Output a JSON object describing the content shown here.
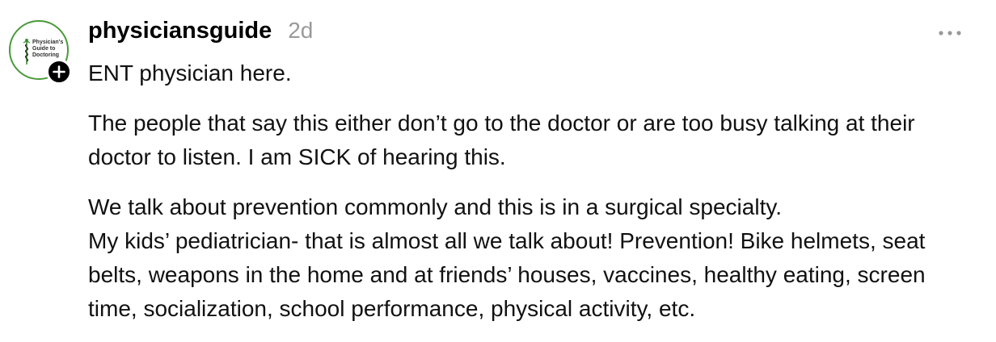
{
  "post": {
    "author": {
      "username": "physiciansguide",
      "avatar_logo_text": "Physician's\nGuide to\nDoctoring",
      "avatar_ring_color": "#4a9a3a",
      "follow_icon": "plus-icon"
    },
    "timestamp": "2d",
    "more_icon": "ellipsis-icon",
    "paragraphs": [
      "ENT physician here.",
      "The people that say this either don’t go to the doctor or are too busy talking at their doctor to listen. I am SICK of hearing this.",
      "We talk about prevention commonly and this is in a surgical specialty.\nMy kids’ pediatrician- that is almost all we talk about! Prevention! Bike helmets, seat belts, weapons in the home and at friends’ houses, vaccines, healthy eating, screen time, socialization, school performance, physical activity, etc."
    ]
  }
}
